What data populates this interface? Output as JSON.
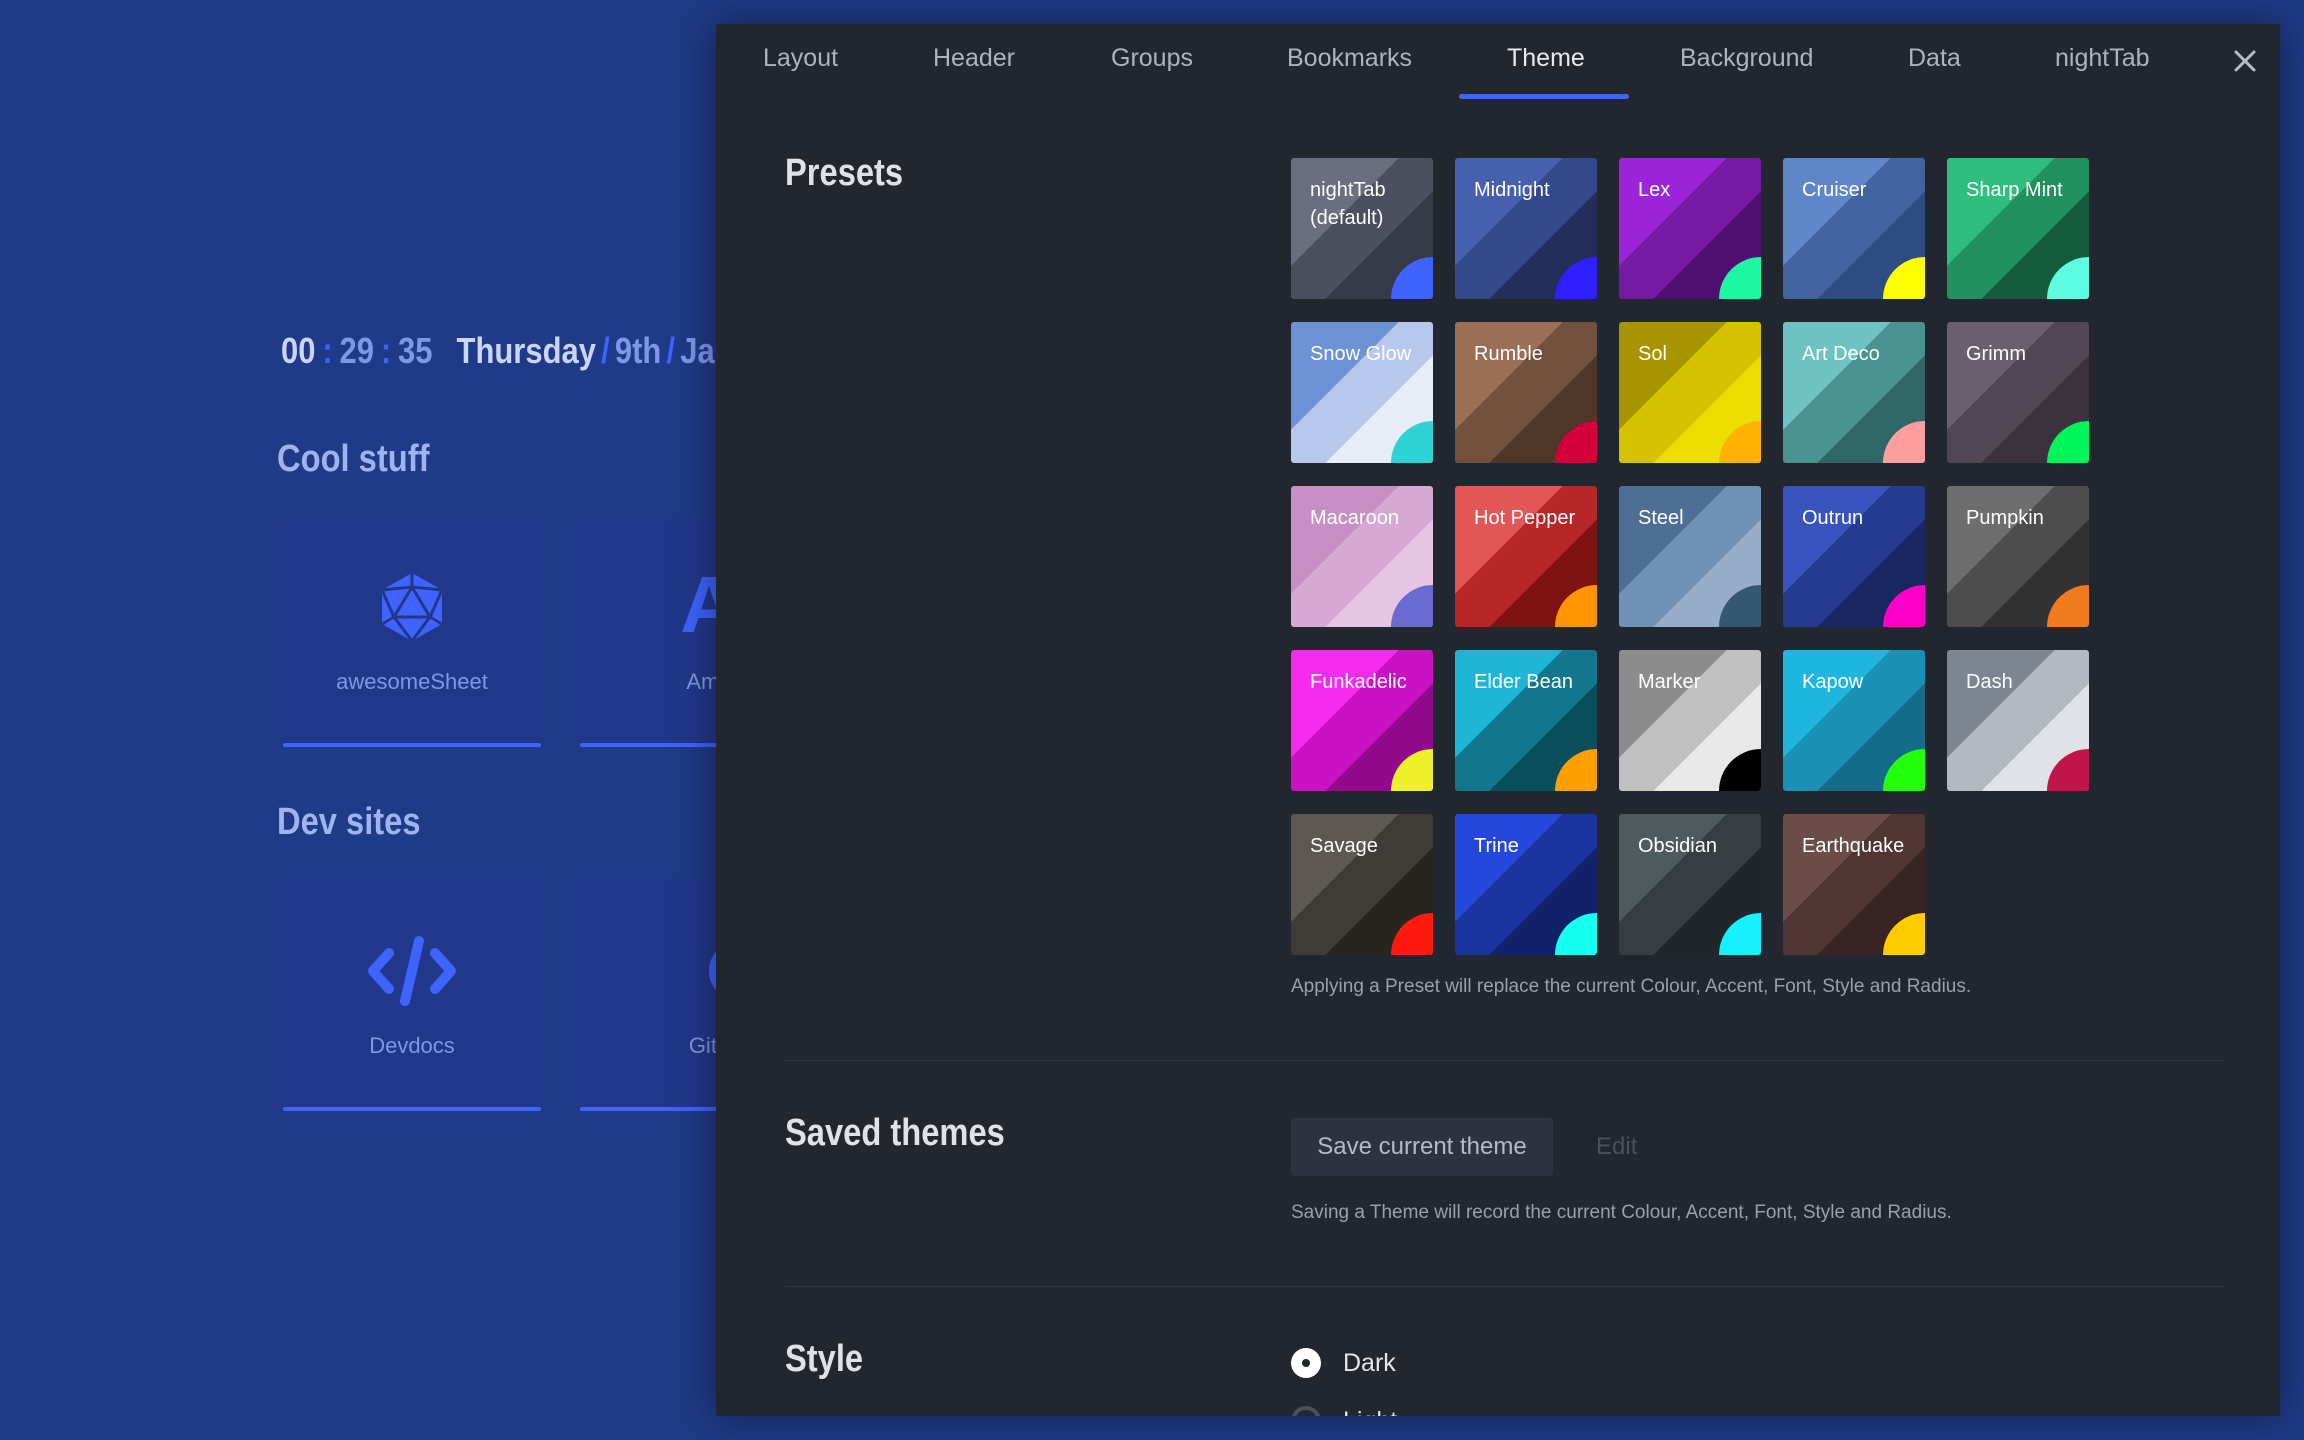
{
  "background_page": {
    "clock": {
      "hours": "00",
      "minutes": "29",
      "seconds": "35",
      "sep": ":"
    },
    "date": {
      "day": "Thursday",
      "date": "9th",
      "month": "Ja",
      "slash": "/"
    },
    "groups": [
      {
        "title": "Cool stuff",
        "bookmarks": [
          {
            "label": "awesomeSheet",
            "icon": "d20-icon"
          },
          {
            "label": "Ama",
            "letters": "A",
            "icon": "letters-icon"
          }
        ]
      },
      {
        "title": "Dev sites",
        "bookmarks": [
          {
            "label": "Devdocs",
            "icon": "code-icon"
          },
          {
            "label": "Gith",
            "icon": "github-icon"
          }
        ]
      }
    ]
  },
  "menu": {
    "tabs": [
      "Layout",
      "Header",
      "Groups",
      "Bookmarks",
      "Theme",
      "Background",
      "Data",
      "nightTab"
    ],
    "active_tab": "Theme",
    "close_icon": "close-icon",
    "accent": "#3e63ff",
    "presets": {
      "title": "Presets",
      "items": [
        {
          "name": "nightTab (default)",
          "c1": "#6a6e7e",
          "c2": "#4b4f5e",
          "c3": "#363a47",
          "accent": "#3e63ff"
        },
        {
          "name": "Midnight",
          "c1": "#4760ad",
          "c2": "#34498a",
          "c3": "#222d5a",
          "accent": "#2f1fff"
        },
        {
          "name": "Lex",
          "c1": "#9c25da",
          "c2": "#741aa3",
          "c3": "#4f0f70",
          "accent": "#1df6a2"
        },
        {
          "name": "Cruiser",
          "c1": "#5f86c9",
          "c2": "#42639f",
          "c3": "#2f4c82",
          "accent": "#fbff00"
        },
        {
          "name": "Sharp Mint",
          "c1": "#2fbe7d",
          "c2": "#229160",
          "c3": "#145c3c",
          "accent": "#5efde1"
        },
        {
          "name": "Snow Glow",
          "c1": "#6d93d4",
          "c2": "#b7c8ec",
          "c3": "#e7ecf7",
          "accent": "#2fd3d3"
        },
        {
          "name": "Rumble",
          "c1": "#9a6f55",
          "c2": "#71503d",
          "c3": "#4e3629",
          "accent": "#d3003c"
        },
        {
          "name": "Sol",
          "c1": "#a69400",
          "c2": "#d4c100",
          "c3": "#ecde00",
          "accent": "#ffb300"
        },
        {
          "name": "Art Deco",
          "c1": "#6fc2c2",
          "c2": "#4b9393",
          "c3": "#2f6768",
          "accent": "#ff9e9e"
        },
        {
          "name": "Grimm",
          "c1": "#6a5f6d",
          "c2": "#514653",
          "c3": "#3b323d",
          "accent": "#00f55a"
        },
        {
          "name": "Macaroon",
          "c1": "#c78fc4",
          "c2": "#d6a8d4",
          "c3": "#e6c6e4",
          "accent": "#6a6bd1"
        },
        {
          "name": "Hot Pepper",
          "c1": "#e15656",
          "c2": "#b82727",
          "c3": "#7f1212",
          "accent": "#ff9500"
        },
        {
          "name": "Steel",
          "c1": "#4f6e93",
          "c2": "#7291b7",
          "c3": "#97adc9",
          "accent": "#36586f"
        },
        {
          "name": "Outrun",
          "c1": "#3854bc",
          "c2": "#263b8f",
          "c3": "#182661",
          "accent": "#ff00c8"
        },
        {
          "name": "Pumpkin",
          "c1": "#6e6e6e",
          "c2": "#4d4d4d",
          "c3": "#323232",
          "accent": "#f07a1e"
        },
        {
          "name": "Funkadelic",
          "c1": "#f72af0",
          "c2": "#c912c3",
          "c3": "#910a8c",
          "accent": "#f0f02a"
        },
        {
          "name": "Elder Bean",
          "c1": "#1fb5d4",
          "c2": "#12778c",
          "c3": "#0a4d5b",
          "accent": "#ff9f00"
        },
        {
          "name": "Marker",
          "c1": "#8c8c8c",
          "c2": "#c0c0c0",
          "c3": "#e9e9e9",
          "accent": "#000000"
        },
        {
          "name": "Kapow",
          "c1": "#1fb6e0",
          "c2": "#1a90b5",
          "c3": "#146c8a",
          "accent": "#22ff0a"
        },
        {
          "name": "Dash",
          "c1": "#7d8591",
          "c2": "#b3b9c1",
          "c3": "#dfe2e6",
          "accent": "#c0144a"
        },
        {
          "name": "Savage",
          "c1": "#5d5851",
          "c2": "#3f3b36",
          "c3": "#28251f",
          "accent": "#ff1a0f"
        },
        {
          "name": "Trine",
          "c1": "#2548da",
          "c2": "#1a349f",
          "c3": "#11226a",
          "accent": "#17ffef"
        },
        {
          "name": "Obsidian",
          "c1": "#4e5a5e",
          "c2": "#363e41",
          "c3": "#20262a",
          "accent": "#17f0ff"
        },
        {
          "name": "Earthquake",
          "c1": "#6b4c48",
          "c2": "#503633",
          "c3": "#372321",
          "accent": "#ffcc00"
        }
      ],
      "note": "Applying a Preset will replace the current Colour, Accent, Font, Style and Radius."
    },
    "saved_themes": {
      "title": "Saved themes",
      "save_label": "Save current theme",
      "edit_label": "Edit",
      "note": "Saving a Theme will record the current Colour, Accent, Font, Style and Radius."
    },
    "style": {
      "title": "Style",
      "options": [
        "Dark",
        "Light"
      ],
      "selected": "Dark"
    }
  }
}
